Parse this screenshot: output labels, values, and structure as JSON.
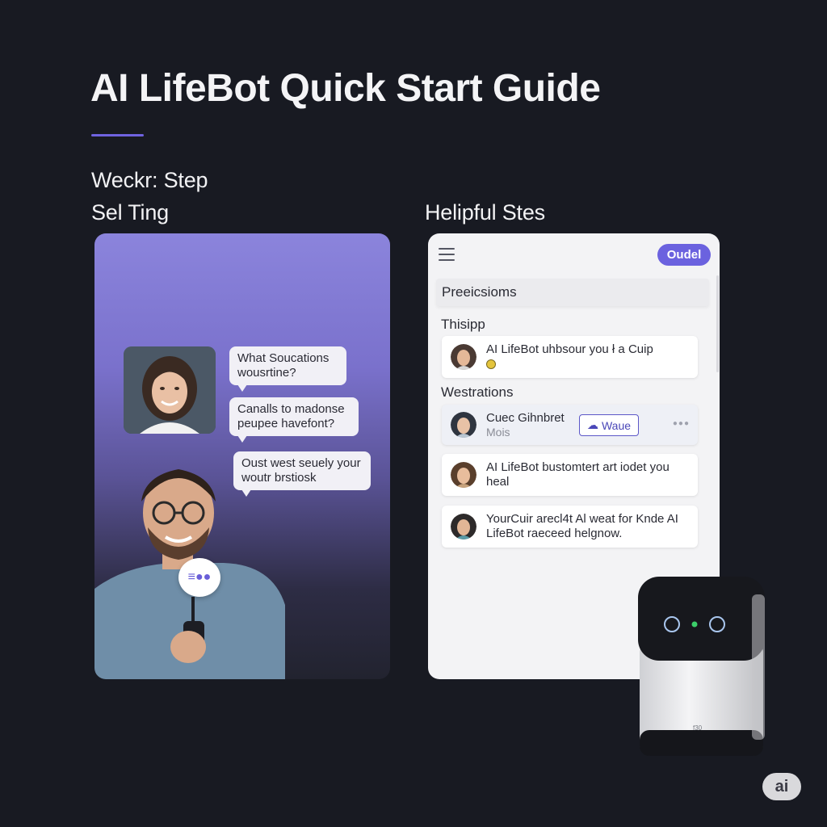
{
  "page": {
    "title": "AI LifeBot Quick Start Guide",
    "accent_color": "#6b62df"
  },
  "sections": {
    "step_label": "Weckr: Step",
    "setting_label": "Sel Ting",
    "helpful_label": "Helipful Stes"
  },
  "photo_card": {
    "bubbles": [
      "What Soucations wousrtine?",
      "Canalls to madonse peupee havefont?",
      "Oust west seuely your woutr brstiosk"
    ],
    "mic_badge_label": "≡●●"
  },
  "app_panel": {
    "menu_icon": "hamburger-icon",
    "pill_button_label": "Oudel",
    "search_value": "Preeicsioms",
    "group_1_label": "Thisipp",
    "group_2_label": "Westrations",
    "cards": [
      {
        "text": "AI LifeBot uhbsour you ł a Cuip"
      },
      {
        "name": "Cuec Gihnbret",
        "sub": "Mois",
        "button_label": "Waue",
        "dots": "●●●"
      },
      {
        "text": "AI LifeBot bustomtert art iodet you heal"
      },
      {
        "text": "YourCuir arecl4t Al weat for Knde AI LifeBot raeceed helgnow."
      }
    ]
  },
  "device": {
    "model_label": "f30",
    "status_color": "#3ccf6a"
  },
  "logo_badge": {
    "label": "ai"
  }
}
